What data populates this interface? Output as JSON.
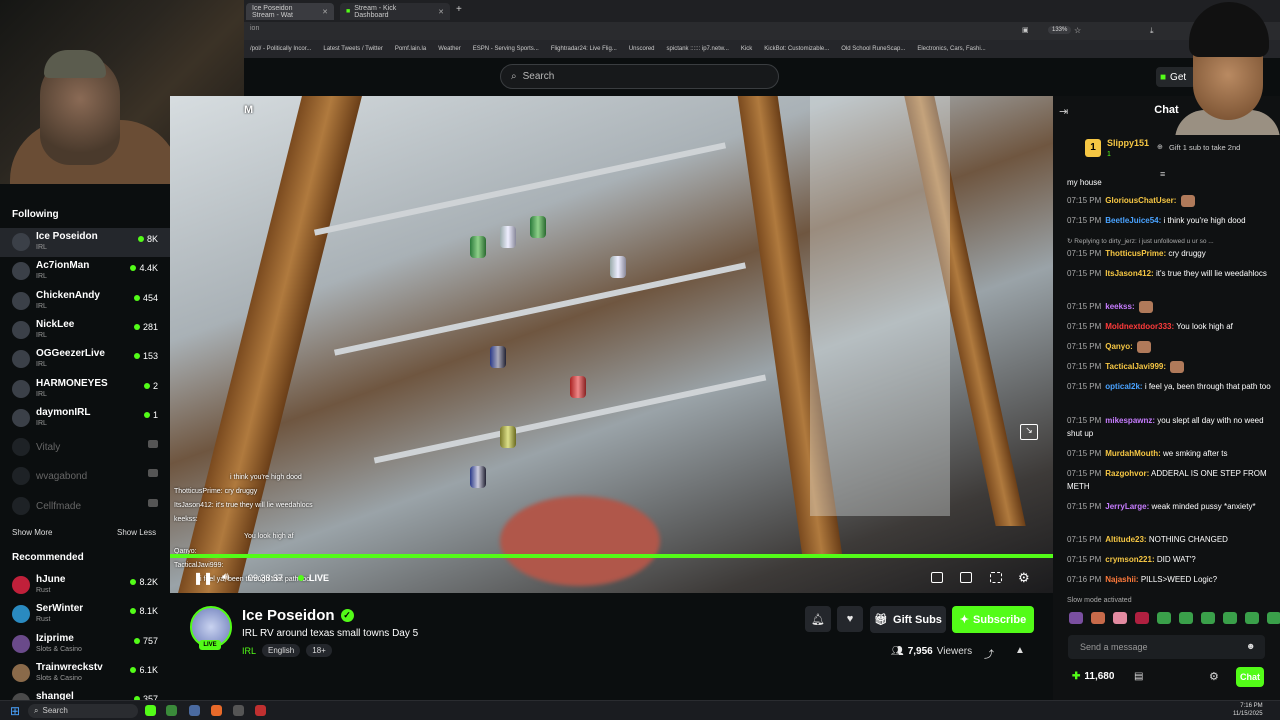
{
  "browser": {
    "tabs": [
      {
        "label": "Ice Poseidon Stream - Wat"
      },
      {
        "label": "Stream - Kick Dashboard"
      }
    ],
    "address_partial": "ion",
    "zoom": "133%",
    "bookmarks": [
      "/pol/ - Politically Incor...",
      "Latest Tweets / Twitter",
      "Pomf.lain.la",
      "Weather",
      "ESPN - Serving Sports...",
      "Flightradar24: Live Flig...",
      "Unscored",
      "spictank :::::: ip7.netw...",
      "Kick",
      "KickBot: Customizable...",
      "Old School RuneScap...",
      "Electronics, Cars, Fashi..."
    ]
  },
  "topnav": {
    "search_placeholder": "Search",
    "get_label": "Get"
  },
  "sidebar": {
    "following_title": "Following",
    "channels": [
      {
        "name": "Ice Poseidon",
        "category": "IRL",
        "viewers": "8K",
        "live": true
      },
      {
        "name": "Ac7ionMan",
        "category": "IRL",
        "viewers": "4.4K",
        "live": true
      },
      {
        "name": "ChickenAndy",
        "category": "IRL",
        "viewers": "454",
        "live": true
      },
      {
        "name": "NickLee",
        "category": "IRL",
        "viewers": "281",
        "live": true
      },
      {
        "name": "OGGeezerLive",
        "category": "IRL",
        "viewers": "153",
        "live": true
      },
      {
        "name": "HARMONEYES",
        "category": "IRL",
        "viewers": "2",
        "live": true
      },
      {
        "name": "daymonIRL",
        "category": "IRL",
        "viewers": "1",
        "live": true
      },
      {
        "name": "Vitaly",
        "category": "",
        "viewers": "",
        "live": false
      },
      {
        "name": "wvagabond",
        "category": "",
        "viewers": "",
        "live": false
      },
      {
        "name": "Cellfmade",
        "category": "",
        "viewers": "",
        "live": false
      }
    ],
    "show_more": "Show More",
    "show_less": "Show Less",
    "recommended_title": "Recommended",
    "recommended": [
      {
        "name": "hJune",
        "category": "Rust",
        "viewers": "8.2K"
      },
      {
        "name": "SerWinter",
        "category": "Rust",
        "viewers": "8.1K"
      },
      {
        "name": "Iziprime",
        "category": "Slots & Casino",
        "viewers": "757"
      },
      {
        "name": "Trainwreckstv",
        "category": "Slots & Casino",
        "viewers": "6.1K"
      },
      {
        "name": "shangel",
        "category": "",
        "viewers": "357"
      }
    ]
  },
  "video": {
    "overlay_letter": "M",
    "overlay_chat": [
      "i think you're high dood",
      "ThotticusPrime: cry druggy",
      "ItsJason412: it's true they will lie weedahlocs",
      "keekss:",
      "You look high af",
      "Qanyo:",
      "TacticalJavi999:",
      "i feel ya, been through that path too"
    ],
    "time": "09:38:37",
    "live_label": "LIVE"
  },
  "stream_info": {
    "streamer": "Ice Poseidon",
    "title": "IRL RV around texas small towns Day 5",
    "category": "IRL",
    "tags": [
      "English",
      "18+"
    ],
    "live_badge": "LIVE",
    "gift_label": "Gift Subs",
    "subscribe_label": "Subscribe",
    "viewers": "7,956",
    "viewers_label": "Viewers"
  },
  "chat": {
    "title": "Chat",
    "pinned_user": "Slippy151",
    "pinned_rank": "1",
    "pinned_count": "1",
    "pinned_action": "Gift 1 sub to take 2nd",
    "first_line": "my house",
    "messages": [
      {
        "time": "07:15 PM",
        "user": "GloriousChatUser:",
        "text": "",
        "color": "#f6c744"
      },
      {
        "time": "07:15 PM",
        "user": "BeetleJuice54:",
        "text": "i think you're high dood",
        "color": "#4aa3ff"
      },
      {
        "time": "",
        "user": "",
        "text": "Replying to dirty_jerz: i just unfollowed u ur so ...",
        "color": "#aaaaaa"
      },
      {
        "time": "07:15 PM",
        "user": "ThotticusPrime:",
        "text": "cry druggy",
        "color": "#f6c744"
      },
      {
        "time": "07:15 PM",
        "user": "ItsJason412:",
        "text": "it's true they will lie weedahlocs",
        "color": "#f6c744"
      },
      {
        "time": "07:15 PM",
        "user": "keekss:",
        "text": "",
        "color": "#c77dff"
      },
      {
        "time": "07:15 PM",
        "user": "Moldnextdoor333:",
        "text": "You look high af",
        "color": "#ff3b3b"
      },
      {
        "time": "07:15 PM",
        "user": "Qanyo:",
        "text": "",
        "color": "#f6c744"
      },
      {
        "time": "07:15 PM",
        "user": "TacticalJavi999:",
        "text": "",
        "color": "#f6c744"
      },
      {
        "time": "07:15 PM",
        "user": "optical2k:",
        "text": "i feel ya, been through that path too",
        "color": "#4aa3ff"
      },
      {
        "time": "07:15 PM",
        "user": "mikespawnz:",
        "text": "you slept all day with no weed shut up",
        "color": "#c77dff"
      },
      {
        "time": "07:15 PM",
        "user": "MurdahMouth:",
        "text": "we smking after ts",
        "color": "#f6c744"
      },
      {
        "time": "07:15 PM",
        "user": "Razgohvor:",
        "text": "ADDERAL IS ONE STEP FROM METH",
        "color": "#f6c744"
      },
      {
        "time": "07:15 PM",
        "user": "JerryLarge:",
        "text": "weak minded pussy *anxiety*",
        "color": "#c77dff"
      },
      {
        "time": "07:15 PM",
        "user": "Altitude23:",
        "text": "NOTHING CHANGED",
        "color": "#f6c744"
      },
      {
        "time": "07:15 PM",
        "user": "crymson221:",
        "text": "DID WAT'?",
        "color": "#f6c744"
      },
      {
        "time": "07:16 PM",
        "user": "Najashii:",
        "text": "PILLS>WEED Logic?",
        "color": "#ff7a3b"
      }
    ],
    "slow_mode": "Slow mode activated",
    "input_placeholder": "Send a message",
    "points": "11,680",
    "chat_button": "Chat"
  },
  "taskbar": {
    "search": "Search",
    "time": "7:16 PM",
    "date": "11/15/2025"
  },
  "colors": {
    "accent": "#53fc18",
    "background": "#0b0e0f"
  }
}
